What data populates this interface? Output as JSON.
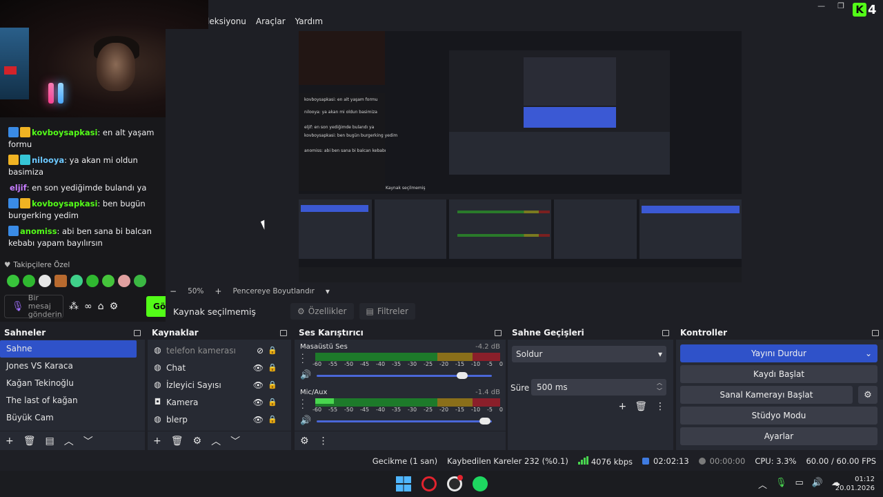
{
  "menu": {
    "items": [
      "leksiyonu",
      "Araçlar",
      "Yardım"
    ]
  },
  "chat": {
    "messages": [
      {
        "user": "kovboysapkasi",
        "user_color": "#53fc18",
        "text": ": en alt yaşam formu",
        "badges": [
          "blue",
          "gold"
        ]
      },
      {
        "user": "nilooya",
        "user_color": "#6cc8ff",
        "text": ": ya akan mi oldun basimiza",
        "badges": [
          "gold",
          "teal"
        ]
      },
      {
        "user": "eljif",
        "user_color": "#c77dff",
        "text": ": en son yediğimde bulandı ya",
        "badges": []
      },
      {
        "user": "kovboysapkasi",
        "user_color": "#53fc18",
        "text": ": ben bugün burgerking yedim",
        "badges": [
          "blue",
          "gold"
        ]
      },
      {
        "user": "anomiss",
        "user_color": "#53fc18",
        "text": ": abi ben sana bi balcan kebabı yapam bayılırsın",
        "badges": [
          "blue"
        ]
      }
    ],
    "followers_only": "Takipçilere Özel",
    "input_placeholder_1": "Bir",
    "input_placeholder_2": "mesaj",
    "input_placeholder_3": "gönderin",
    "send_label": "Gö"
  },
  "preview": {
    "zoom": "50%",
    "resize_label": "Pencereye Boyutlandır"
  },
  "context": {
    "no_source": "Kaynak seçilmemiş",
    "properties": "Özellikler",
    "filters": "Filtreler"
  },
  "scenes": {
    "title": "Sahneler",
    "items": [
      "Sahne",
      "Jones VS Karaca",
      "Kağan Tekinoğlu",
      "The last of kağan",
      "Büyük Cam"
    ],
    "active_index": 0
  },
  "sources": {
    "title": "Kaynaklar",
    "items": [
      {
        "label": "telefon kamerası",
        "icon": "globe-icon",
        "visible": false
      },
      {
        "label": "Chat",
        "icon": "globe-icon",
        "visible": true
      },
      {
        "label": "İzleyici Sayısı",
        "icon": "globe-icon",
        "visible": true
      },
      {
        "label": "Kamera",
        "icon": "camera-icon",
        "visible": true
      },
      {
        "label": "blerp",
        "icon": "globe-icon",
        "visible": true
      }
    ]
  },
  "mixer": {
    "title": "Ses Karıştırıcı",
    "scale": [
      "-60",
      "-55",
      "-50",
      "-45",
      "-40",
      "-35",
      "-30",
      "-25",
      "-20",
      "-15",
      "-10",
      "-5",
      "0"
    ],
    "channels": [
      {
        "name": "Masaüstü Ses",
        "db": "-4.2 dB",
        "level": 0.0,
        "volume": 0.83
      },
      {
        "name": "Mic/Aux",
        "db": "-1.4 dB",
        "level": 0.1,
        "volume": 0.96
      }
    ]
  },
  "transitions": {
    "title": "Sahne Geçişleri",
    "selected": "Soldur",
    "duration_label": "Süre",
    "duration_value": "500 ms"
  },
  "controls": {
    "title": "Kontroller",
    "stop_stream": "Yayını Durdur",
    "start_record": "Kaydı Başlat",
    "start_virtual_cam": "Sanal Kamerayı Başlat",
    "studio_mode": "Stüdyo Modu",
    "settings": "Ayarlar"
  },
  "status": {
    "delay": "Gecikme (1 san)",
    "dropped": "Kaybedilen Kareler 232 (%0.1)",
    "bitrate": "4076 kbps",
    "live_time": "02:02:13",
    "rec_time": "00:00:00",
    "cpu": "CPU: 3.3%",
    "fps": "60.00 / 60.00 FPS"
  },
  "taskbar": {
    "time": "01:12",
    "date": "20.01.2026"
  },
  "colors": {
    "accent": "#2f52c9",
    "kick_green": "#53fc18"
  }
}
